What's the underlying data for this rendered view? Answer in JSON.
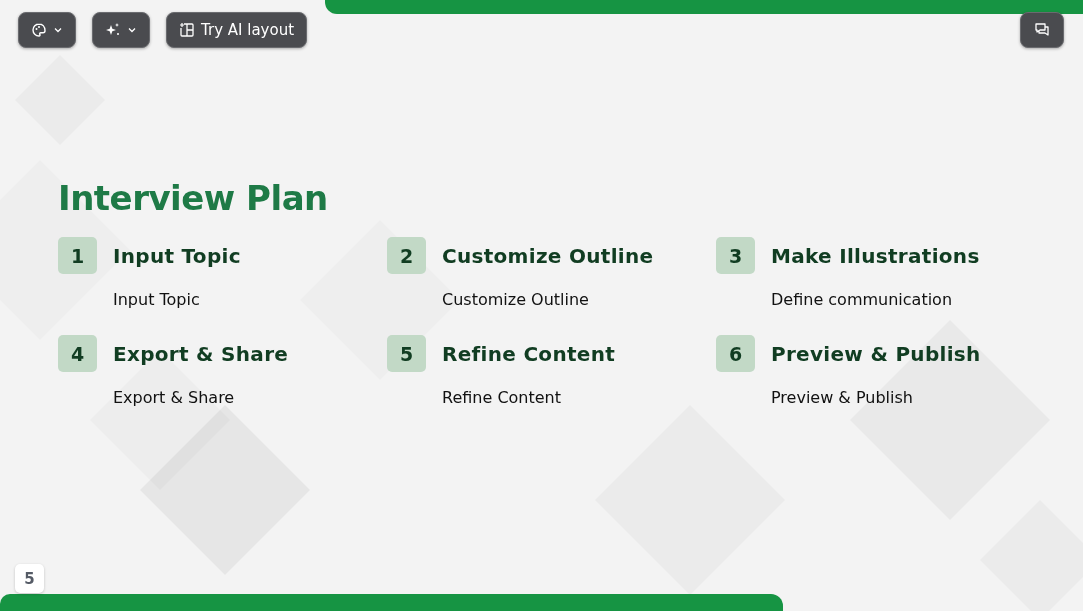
{
  "toolbar": {
    "ai_layout_label": "Try AI layout"
  },
  "slide": {
    "title": "Interview Plan",
    "steps": [
      {
        "number": "1",
        "heading": "Input Topic",
        "text": "Input Topic"
      },
      {
        "number": "2",
        "heading": "Customize Outline",
        "text": "Customize Outline"
      },
      {
        "number": "3",
        "heading": "Make Illustrations",
        "text": "Define communication"
      },
      {
        "number": "4",
        "heading": "Export & Share",
        "text": "Export & Share"
      },
      {
        "number": "5",
        "heading": "Refine Content",
        "text": "Refine Content"
      },
      {
        "number": "6",
        "heading": "Preview & Publish",
        "text": "Preview & Publish"
      }
    ],
    "page_number": "5"
  }
}
